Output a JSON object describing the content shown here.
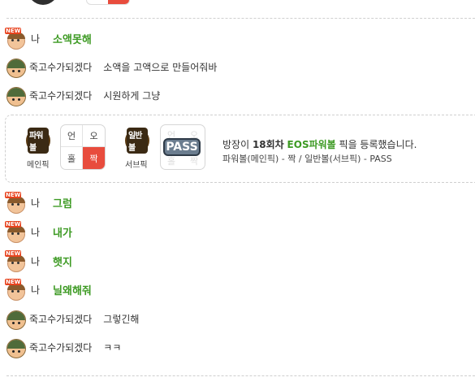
{
  "top": {
    "card_label": ""
  },
  "messages": [
    {
      "id": "m1",
      "avatar": "new",
      "nick": "나",
      "text": "소액못해",
      "style": "green"
    },
    {
      "id": "m2",
      "avatar": "soldier",
      "nick": "죽고수가되겠다",
      "text": "소액을 고액으로 만들어줘바",
      "style": "plain"
    },
    {
      "id": "m3",
      "avatar": "soldier",
      "nick": "죽고수가되겠다",
      "text": "시원하게 그냥",
      "style": "plain"
    },
    {
      "id": "m4",
      "avatar": "new",
      "nick": "나",
      "text": "그럼",
      "style": "green"
    },
    {
      "id": "m5",
      "avatar": "new",
      "nick": "나",
      "text": "내가",
      "style": "green"
    },
    {
      "id": "m6",
      "avatar": "new",
      "nick": "나",
      "text": "햇지",
      "style": "green"
    },
    {
      "id": "m7",
      "avatar": "new",
      "nick": "나",
      "text": "닐왜해줘",
      "style": "green"
    },
    {
      "id": "m8",
      "avatar": "soldier",
      "nick": "죽고수가되겠다",
      "text": "그렇긴해",
      "style": "plain"
    },
    {
      "id": "m9",
      "avatar": "soldier",
      "nick": "죽고수가되겠다",
      "text": "ㅋㅋ",
      "style": "plain"
    }
  ],
  "pick": {
    "main": {
      "ball_label": "파워볼",
      "caption": "메인픽",
      "cells": [
        "언",
        "오",
        "홀",
        "짝"
      ],
      "selected": "짝"
    },
    "sub": {
      "ball_label": "일반볼",
      "caption": "서브픽",
      "cells": [
        "언",
        "오",
        "홀",
        "짝"
      ],
      "pass_label": "PASS"
    },
    "notice": {
      "prefix": "방장이 ",
      "round": "18회차",
      "game": "EOS파워볼",
      "suffix": " 픽을 등록했습니다.",
      "summary": "파워볼(메인픽) - 짝 / 일반볼(서브픽) - PASS"
    }
  },
  "icons": {
    "new_badge": "new-badge-icon",
    "avatar_new": "new-user-avatar-icon",
    "avatar_soldier": "soldier-avatar-icon",
    "powerball": "powerball-icon",
    "normalball": "normalball-icon",
    "pass": "pass-badge-icon"
  },
  "colors": {
    "accent_green": "#3d9a23",
    "pick_red": "#e84c3d",
    "divider": "#cfcfcf"
  }
}
